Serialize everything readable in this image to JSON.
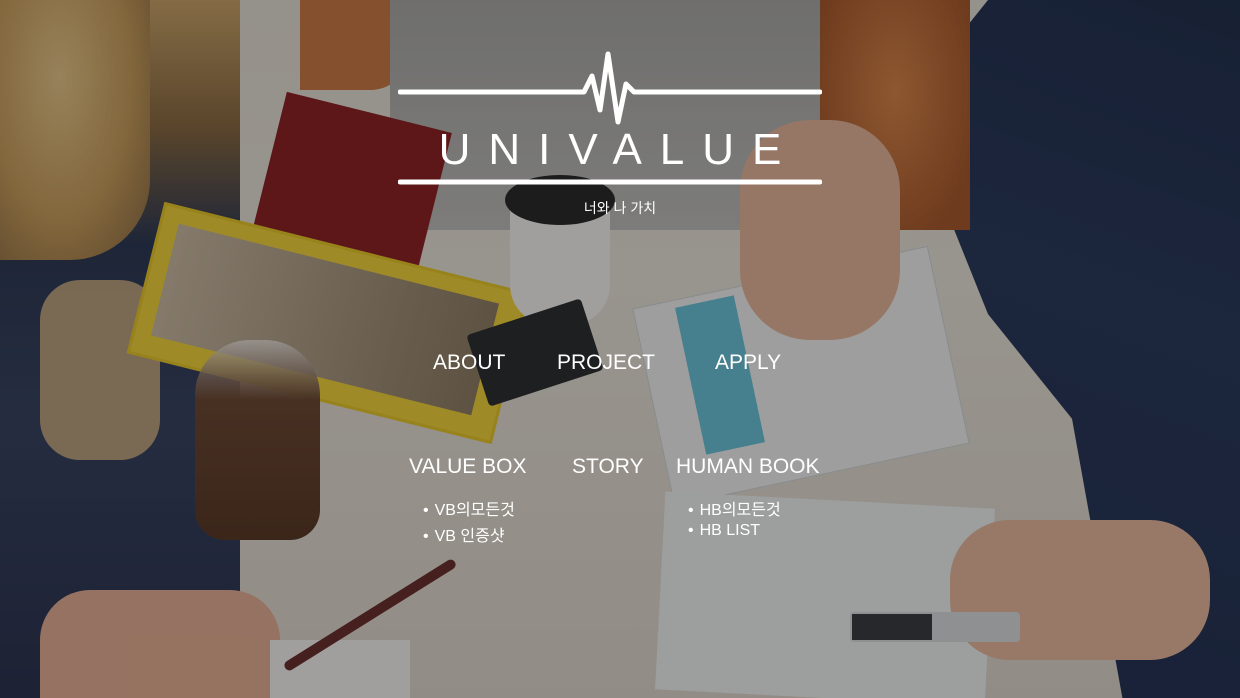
{
  "logo": {
    "title": "UNIVALUE",
    "slogan": "너와 나 가치"
  },
  "nav": {
    "primary": [
      {
        "label": "ABOUT"
      },
      {
        "label": "PROJECT"
      },
      {
        "label": "APPLY"
      }
    ],
    "secondary": [
      {
        "label": "VALUE BOX",
        "links": [
          {
            "label": "VB의모든것"
          },
          {
            "label": "VB 인증샷"
          }
        ]
      },
      {
        "label": "STORY",
        "links": []
      },
      {
        "label": "HUMAN BOOK",
        "links": [
          {
            "label": "HB의모든것"
          },
          {
            "label": "HB LIST"
          }
        ]
      }
    ]
  },
  "colors": {
    "text": "#ffffff",
    "overlay": "rgba(0,0,0,0.34)"
  }
}
